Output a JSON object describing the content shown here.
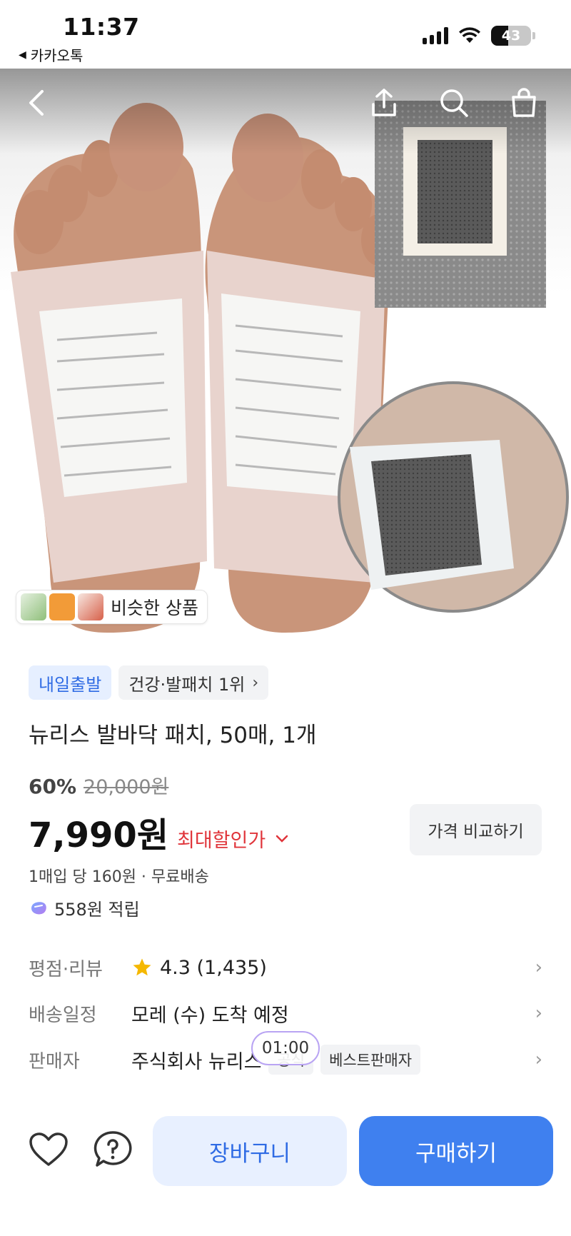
{
  "status_bar": {
    "time": "11:37",
    "back_app": "카카오톡",
    "battery": "43",
    "battery_level": 0.43
  },
  "hero": {
    "nav_icons": [
      "back-icon",
      "share-icon",
      "search-icon",
      "cart-icon"
    ]
  },
  "similar": {
    "label": "비슷한 상품"
  },
  "badges": {
    "delivery": "내일출발",
    "rank": "건강·발패치 1위"
  },
  "product": {
    "title": "뉴리스 발바닥 패치, 50매, 1개",
    "discount_rate": "60%",
    "original_price": "20,000원",
    "price": "7,990원",
    "max_discount": "최대할인가",
    "compare_button": "가격 비교하기",
    "unit_price": "1매입 당 160원 · 무료배송",
    "points": "558원 적립"
  },
  "info": {
    "rating_label": "평점·리뷰",
    "rating_value": "4.3 (1,435)",
    "shipping_label": "배송일정",
    "shipping_value": "모레 (수) 도착 예정",
    "seller_label": "판매자",
    "seller_value": "주식회사 뉴리스",
    "seller_badge_1": "공식",
    "seller_badge_2": "베스트판매자",
    "timer": "01:00"
  },
  "bottom_bar": {
    "cart_button": "장바구니",
    "buy_button": "구매하기"
  },
  "colors": {
    "accent": "#3f80ef",
    "accent_light": "#e8f0ff",
    "sale_red": "#e0353b",
    "star": "#f5b800"
  }
}
